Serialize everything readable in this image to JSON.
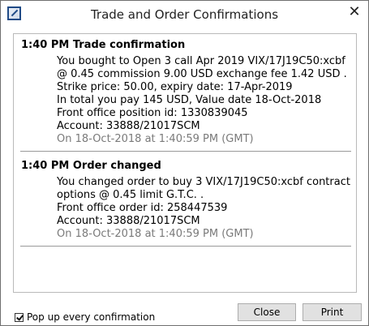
{
  "window": {
    "title": "Trade and Order Confirmations",
    "close_glyph": "✕"
  },
  "entries": [
    {
      "heading": "1:40 PM Trade confirmation",
      "lines": [
        "You bought to Open 3 call Apr 2019 VIX/17J19C50:xcbf",
        "@ 0.45 commission 9.00 USD exchange fee 1.42 USD .",
        "Strike price: 50.00, expiry date: 17-Apr-2019",
        "In total you pay 145 USD, Value date 18-Oct-2018",
        "Front office position id: 1330839045",
        "Account: 33888/21017SCM"
      ],
      "timestamp": "On 18-Oct-2018 at 1:40:59 PM (GMT)"
    },
    {
      "heading": "1:40 PM Order changed",
      "lines": [
        "You changed order to buy 3 VIX/17J19C50:xcbf contract",
        "options @ 0.45 limit G.T.C. .",
        "Front office order id: 258447539",
        "Account: 33888/21017SCM"
      ],
      "timestamp": "On 18-Oct-2018 at 1:40:59 PM (GMT)"
    }
  ],
  "footer": {
    "popup_checkbox_label": "Pop up every confirmation",
    "popup_checked": true,
    "close_label": "Close",
    "print_label": "Print"
  },
  "icons": {
    "app": "app-icon",
    "close": "close-icon"
  }
}
